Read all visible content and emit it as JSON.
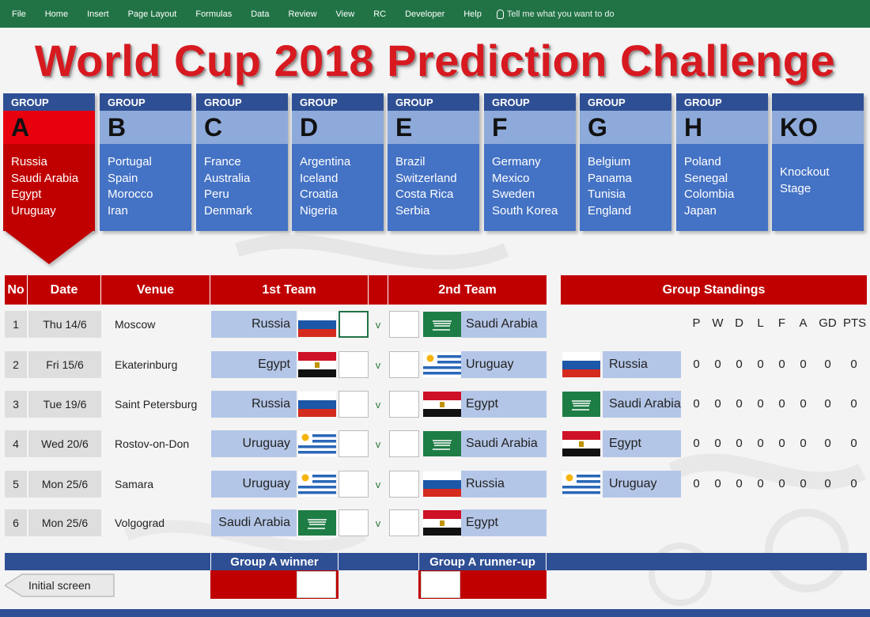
{
  "ribbon": {
    "menu": [
      "File",
      "Home",
      "Insert",
      "Page Layout",
      "Formulas",
      "Data",
      "Review",
      "View",
      "RC",
      "Developer",
      "Help"
    ],
    "tell_me": "Tell me what you want to do"
  },
  "title": "World Cup 2018 Prediction Challenge",
  "groups": [
    {
      "header": "GROUP",
      "letter": "A",
      "teams": [
        "Russia",
        "Saudi Arabia",
        "Egypt",
        "Uruguay"
      ],
      "selected": true
    },
    {
      "header": "GROUP",
      "letter": "B",
      "teams": [
        "Portugal",
        "Spain",
        "Morocco",
        "Iran"
      ]
    },
    {
      "header": "GROUP",
      "letter": "C",
      "teams": [
        "France",
        "Australia",
        "Peru",
        "Denmark"
      ]
    },
    {
      "header": "GROUP",
      "letter": "D",
      "teams": [
        "Argentina",
        "Iceland",
        "Croatia",
        "Nigeria"
      ]
    },
    {
      "header": "GROUP",
      "letter": "E",
      "teams": [
        "Brazil",
        "Switzerland",
        "Costa Rica",
        "Serbia"
      ]
    },
    {
      "header": "GROUP",
      "letter": "F",
      "teams": [
        "Germany",
        "Mexico",
        "Sweden",
        "South Korea"
      ]
    },
    {
      "header": "GROUP",
      "letter": "G",
      "teams": [
        "Belgium",
        "Panama",
        "Tunisia",
        "England"
      ]
    },
    {
      "header": "GROUP",
      "letter": "H",
      "teams": [
        "Poland",
        "Senegal",
        "Colombia",
        "Japan"
      ]
    },
    {
      "header": "",
      "letter": "KO",
      "teams": [
        "Knockout",
        "Stage"
      ]
    }
  ],
  "table_headers": {
    "no": "No",
    "date": "Date",
    "venue": "Venue",
    "team1": "1st Team",
    "team2": "2nd Team"
  },
  "vs_label": "v",
  "matches": [
    {
      "no": "1",
      "date": "Thu 14/6",
      "venue": "Moscow",
      "team1": "Russia",
      "flag1": "russia",
      "score1": "",
      "score2": "",
      "team2": "Saudi Arabia",
      "flag2": "saudi"
    },
    {
      "no": "2",
      "date": "Fri 15/6",
      "venue": "Ekaterinburg",
      "team1": "Egypt",
      "flag1": "egypt",
      "score1": "",
      "score2": "",
      "team2": "Uruguay",
      "flag2": "uruguay"
    },
    {
      "no": "3",
      "date": "Tue 19/6",
      "venue": "Saint Petersburg",
      "team1": "Russia",
      "flag1": "russia",
      "score1": "",
      "score2": "",
      "team2": "Egypt",
      "flag2": "egypt"
    },
    {
      "no": "4",
      "date": "Wed 20/6",
      "venue": "Rostov-on-Don",
      "team1": "Uruguay",
      "flag1": "uruguay",
      "score1": "",
      "score2": "",
      "team2": "Saudi Arabia",
      "flag2": "saudi"
    },
    {
      "no": "5",
      "date": "Mon 25/6",
      "venue": "Samara",
      "team1": "Uruguay",
      "flag1": "uruguay",
      "score1": "",
      "score2": "",
      "team2": "Russia",
      "flag2": "russia"
    },
    {
      "no": "6",
      "date": "Mon 25/6",
      "venue": "Volgograd",
      "team1": "Saudi Arabia",
      "flag1": "saudi",
      "score1": "",
      "score2": "",
      "team2": "Egypt",
      "flag2": "egypt"
    }
  ],
  "standings": {
    "title": "Group Standings",
    "columns": [
      "P",
      "W",
      "D",
      "L",
      "F",
      "A",
      "GD",
      "PTS"
    ],
    "rows": [
      {
        "team": "Russia",
        "flag": "russia",
        "values": [
          "0",
          "0",
          "0",
          "0",
          "0",
          "0",
          "0",
          "0"
        ]
      },
      {
        "team": "Saudi Arabia",
        "flag": "saudi",
        "values": [
          "0",
          "0",
          "0",
          "0",
          "0",
          "0",
          "0",
          "0"
        ]
      },
      {
        "team": "Egypt",
        "flag": "egypt",
        "values": [
          "0",
          "0",
          "0",
          "0",
          "0",
          "0",
          "0",
          "0"
        ]
      },
      {
        "team": "Uruguay",
        "flag": "uruguay",
        "values": [
          "0",
          "0",
          "0",
          "0",
          "0",
          "0",
          "0",
          "0"
        ]
      }
    ]
  },
  "bottom": {
    "winner_label": "Group A winner",
    "runnerup_label": "Group A runner-up",
    "initial_screen": "Initial screen"
  },
  "colors": {
    "excel_green": "#217346",
    "group_header": "#2f4f94",
    "group_body": "#4472c4",
    "group_letter": "#8eaadb",
    "accent_red": "#c00000",
    "team_cell": "#b4c6e7"
  }
}
